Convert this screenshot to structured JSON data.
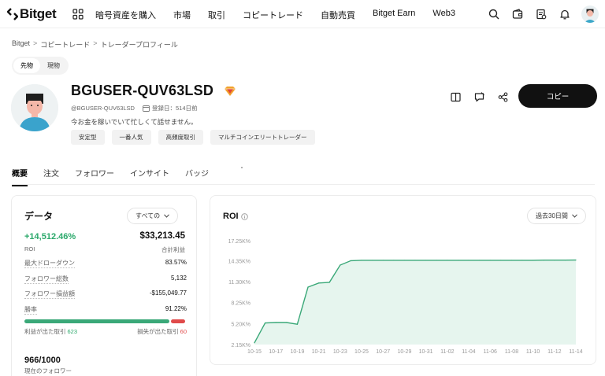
{
  "brand": {
    "name": "Bitget",
    "accent": "#111111",
    "positive": "#2aa86a",
    "negative": "#e04a4a"
  },
  "nav": {
    "items": [
      "暗号資産を購入",
      "市場",
      "取引",
      "コピートレード",
      "自動売買",
      "Bitget Earn",
      "Web3"
    ]
  },
  "top_icons": [
    "search-icon",
    "wallet-icon",
    "orders-icon",
    "bell-icon",
    "user-avatar"
  ],
  "breadcrumb": [
    "Bitget",
    "コピートレード",
    "トレーダープロフィール"
  ],
  "segment": {
    "options": [
      "先物",
      "現物"
    ],
    "selected": "先物"
  },
  "profile": {
    "username": "BGUSER-QUV63LSD",
    "handle": "@BGUSER-QUV63LSD",
    "registered": "登録日：514日前",
    "bio": "今お金を稼いでいて忙しくて話せません。",
    "tags": [
      "安定型",
      "一番人気",
      "高頻度取引",
      "マルチコインエリートトレーダー"
    ],
    "copy_label": "コピー"
  },
  "tabs": {
    "items": [
      "概要",
      "注文",
      "フォロワー",
      "インサイト",
      "バッジ"
    ],
    "active": "概要"
  },
  "data_card": {
    "title": "データ",
    "period": "すべての",
    "roi": "+14,512.46%",
    "roi_label": "ROI",
    "pnl": "$33,213.45",
    "pnl_label": "合計利益",
    "stats": [
      {
        "label": "最大ドローダウン",
        "value": "83.57%"
      },
      {
        "label": "フォロワー総数",
        "value": "5,132"
      },
      {
        "label": "フォロワー損益額",
        "value": "-$155,049.77"
      },
      {
        "label": "勝率",
        "value": "91.22%"
      }
    ],
    "win_rate": 0.9122,
    "profit_trades_label": "利益が出た取引",
    "profit_trades": "623",
    "loss_trades_label": "損失が出た取引",
    "loss_trades": "60",
    "followers": "966/1000",
    "followers_label": "現在のフォロワー"
  },
  "roi_card": {
    "title": "ROI",
    "period": "過去30日間"
  },
  "chart_data": {
    "type": "area",
    "title": "ROI",
    "y_tick_labels": [
      "2.15K%",
      "5.20K%",
      "8.25K%",
      "11.30K%",
      "14.35K%",
      "17.25K%"
    ],
    "y_ticks": [
      2150,
      5200,
      8250,
      11300,
      14350,
      17250
    ],
    "ylim": [
      2150,
      17250
    ],
    "x_tick_labels": [
      "10-15",
      "10-17",
      "10-19",
      "10-21",
      "10-23",
      "10-25",
      "10-27",
      "10-29",
      "10-31",
      "11-02",
      "11-04",
      "11-06",
      "11-08",
      "11-10",
      "11-12",
      "11-14"
    ],
    "series": [
      {
        "x": [
          "10-15",
          "10-16",
          "10-17",
          "10-18",
          "10-19",
          "10-20",
          "10-21",
          "10-22",
          "10-23",
          "10-24",
          "10-25",
          "10-26",
          "10-27",
          "10-28",
          "10-29",
          "10-30",
          "10-31",
          "11-01",
          "11-02",
          "11-03",
          "11-04",
          "11-05",
          "11-06",
          "11-07",
          "11-08",
          "11-09",
          "11-10",
          "11-11",
          "11-12",
          "11-13",
          "11-14"
        ],
        "values": [
          2400,
          5300,
          5350,
          5350,
          5100,
          10500,
          11100,
          11200,
          13700,
          14350,
          14400,
          14400,
          14400,
          14400,
          14400,
          14400,
          14400,
          14400,
          14400,
          14400,
          14400,
          14400,
          14400,
          14400,
          14400,
          14400,
          14400,
          14420,
          14430,
          14430,
          14440
        ]
      }
    ],
    "line_color": "#3aa878",
    "fill_color": "#e6f5ee",
    "grid": false
  }
}
